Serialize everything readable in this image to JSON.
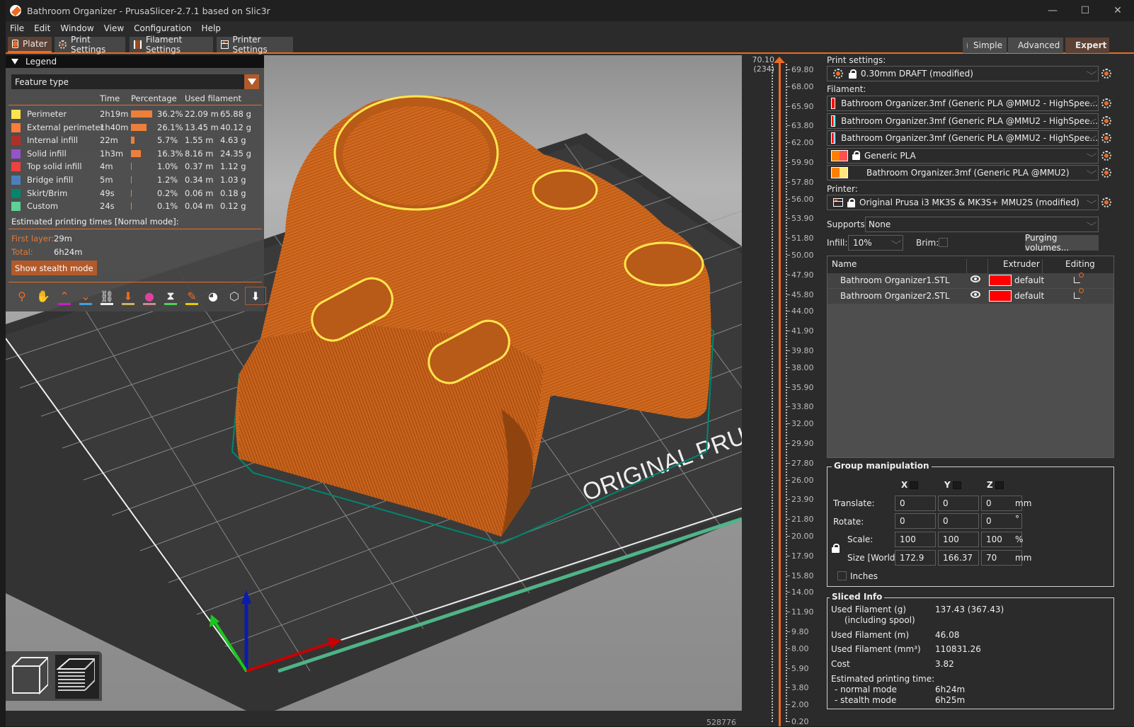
{
  "window": {
    "title": "Bathroom Organizer - PrusaSlicer-2.7.1 based on Slic3r",
    "controls": [
      "minimize",
      "maximize",
      "close"
    ]
  },
  "menu": [
    "File",
    "Edit",
    "Window",
    "View",
    "Configuration",
    "Help"
  ],
  "tabs": [
    {
      "label": "Plater",
      "active": true
    },
    {
      "label": "Print Settings",
      "active": false
    },
    {
      "label": "Filament Settings",
      "active": false
    },
    {
      "label": "Printer Settings",
      "active": false
    }
  ],
  "modes": [
    {
      "label": "Simple",
      "color": "#6ce01d",
      "active": false
    },
    {
      "label": "Advanced",
      "color": "#f5d400",
      "active": false
    },
    {
      "label": "Expert",
      "color": "#e00000",
      "active": true
    }
  ],
  "legend": {
    "title": "Legend",
    "view_type": "Feature type",
    "columns": {
      "time": "Time",
      "percentage": "Percentage",
      "used": "Used filament"
    },
    "rows": [
      {
        "name": "Perimeter",
        "color": "#ffe54d",
        "time": "2h19m",
        "percent": 36.2,
        "percent_label": "36.2%",
        "length": "22.09 m",
        "weight": "65.88 g"
      },
      {
        "name": "External perimeter",
        "color": "#ff7d38",
        "time": "1h40m",
        "percent": 26.1,
        "percent_label": "26.1%",
        "length": "13.45 m",
        "weight": "40.12 g"
      },
      {
        "name": "Internal infill",
        "color": "#b03029",
        "time": "22m",
        "percent": 5.7,
        "percent_label": "5.7%",
        "length": "1.55 m",
        "weight": "4.63 g"
      },
      {
        "name": "Solid infill",
        "color": "#9654cc",
        "time": "1h3m",
        "percent": 16.3,
        "percent_label": "16.3%",
        "length": "8.16 m",
        "weight": "24.35 g"
      },
      {
        "name": "Top solid infill",
        "color": "#f04040",
        "time": "4m",
        "percent": 1.0,
        "percent_label": "1.0%",
        "length": "0.37 m",
        "weight": "1.12 g"
      },
      {
        "name": "Bridge infill",
        "color": "#4d80ba",
        "time": "5m",
        "percent": 1.2,
        "percent_label": "1.2%",
        "length": "0.34 m",
        "weight": "1.03 g"
      },
      {
        "name": "Skirt/Brim",
        "color": "#00876e",
        "time": "49s",
        "percent": 0.2,
        "percent_label": "0.2%",
        "length": "0.06 m",
        "weight": "0.18 g"
      },
      {
        "name": "Custom",
        "color": "#5ed194",
        "time": "24s",
        "percent": 0.1,
        "percent_label": "0.1%",
        "length": "0.04 m",
        "weight": "0.12 g"
      }
    ],
    "estimated_title": "Estimated printing times [Normal mode]:",
    "first_layer_label": "First layer:",
    "first_layer": "29m",
    "total_label": "Total:",
    "total": "6h24m",
    "stealth_button": "Show stealth mode",
    "tool_icons": [
      "travel-icon",
      "wipe-hand-icon",
      "retractions-icon",
      "deretractions-icon",
      "seams-icon",
      "tool-changes-icon",
      "color-changes-icon",
      "pause-icon",
      "custom-gcode-icon",
      "center-of-gravity-icon",
      "shells-icon",
      "tool-marker-icon"
    ]
  },
  "viewport": {
    "bed_label": "ORIGINAL PRUSA",
    "move_count": "528776"
  },
  "layer_slider": {
    "top_value": "70.10",
    "top_layer": "(234)",
    "labels": [
      "69.80",
      "68.00",
      "65.90",
      "63.80",
      "62.00",
      "59.90",
      "57.80",
      "56.00",
      "53.90",
      "51.80",
      "50.00",
      "47.90",
      "45.80",
      "44.00",
      "41.90",
      "39.80",
      "38.00",
      "35.90",
      "33.80",
      "32.00",
      "29.90",
      "27.80",
      "26.00",
      "23.90",
      "21.80",
      "20.00",
      "17.90",
      "15.80",
      "14.00",
      "11.90",
      "9.80",
      "8.00",
      "5.90",
      "3.80",
      "2.00",
      "0.20"
    ],
    "range": [
      0.2,
      70.1
    ]
  },
  "sidebar": {
    "print_settings_label": "Print settings:",
    "print_profile": "0.30mm DRAFT (modified)",
    "filament_label": "Filament:",
    "filaments": [
      {
        "name": "Bathroom Organizer.3mf (Generic PLA @MMU2 - HighSpee...",
        "colors": [
          "#ff0000",
          "#ff0000"
        ],
        "locked": false
      },
      {
        "name": "Bathroom Organizer.3mf (Generic PLA @MMU2 - HighSpee...",
        "colors": [
          "#ff0000",
          "#00e6ff"
        ],
        "locked": false
      },
      {
        "name": "Bathroom Organizer.3mf (Generic PLA @MMU2 - HighSpee...",
        "colors": [
          "#ff0000",
          "#40b0ff"
        ],
        "locked": false
      },
      {
        "name": "Generic PLA",
        "colors": [
          "#ff8000",
          "#ff5050"
        ],
        "locked": true
      },
      {
        "name": "Bathroom Organizer.3mf (Generic PLA @MMU2)",
        "colors": [
          "#ff8000",
          "#ffe680"
        ],
        "locked": false
      }
    ],
    "printer_label": "Printer:",
    "printer": "Original Prusa i3 MK3S & MK3S+ MMU2S (modified)",
    "supports_label": "Supports:",
    "supports": "None",
    "infill_label": "Infill:",
    "infill": "10%",
    "brim_label": "Brim:",
    "brim_checked": false,
    "purging_button": "Purging volumes...",
    "object_list": {
      "columns": [
        "Name",
        "",
        "Extruder",
        "Editing"
      ],
      "rows": [
        {
          "name": "Bathroom Organizer1.STL",
          "extruder": "default",
          "color": "#ff0000"
        },
        {
          "name": "Bathroom Organizer2.STL",
          "extruder": "default",
          "color": "#ff0000"
        }
      ]
    },
    "group_manipulation": {
      "title": "Group manipulation",
      "axes": [
        "X",
        "Y",
        "Z"
      ],
      "translate_label": "Translate:",
      "translate": [
        "0",
        "0",
        "0"
      ],
      "translate_unit": "mm",
      "rotate_label": "Rotate:",
      "rotate": [
        "0",
        "0",
        "0"
      ],
      "rotate_unit": "°",
      "scale_label": "Scale:",
      "scale": [
        "100",
        "100",
        "100"
      ],
      "scale_unit": "%",
      "size_label": "Size [World]:",
      "size": [
        "172.9",
        "166.37",
        "70"
      ],
      "size_unit": "mm",
      "inches_label": "Inches",
      "inches_checked": false
    },
    "sliced_info": {
      "title": "Sliced Info",
      "used_g_label": "Used Filament (g)",
      "used_g_sub": "(including spool)",
      "used_g": "137.43 (367.43)",
      "used_m_label": "Used Filament (m)",
      "used_m": "46.08",
      "used_mm3_label": "Used Filament (mm³)",
      "used_mm3": "110831.26",
      "cost_label": "Cost",
      "cost": "3.82",
      "est_label": "Estimated printing time:",
      "normal_label": "- normal mode",
      "normal": "6h24m",
      "stealth_label": "- stealth mode",
      "stealth": "6h25m"
    }
  }
}
